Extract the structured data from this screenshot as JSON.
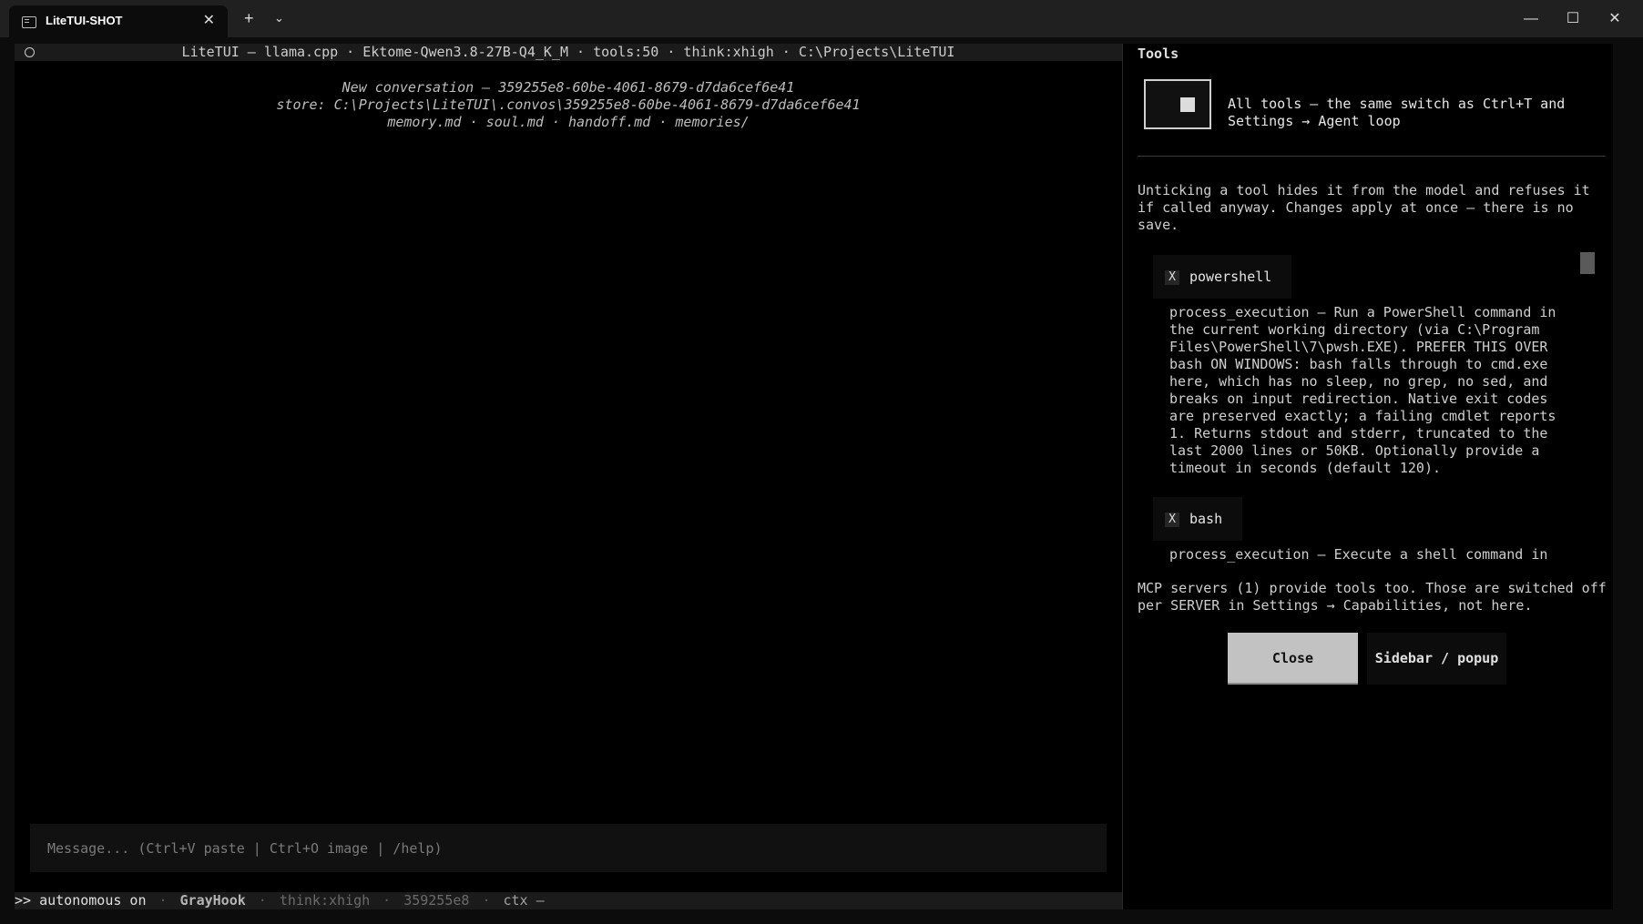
{
  "window": {
    "tab_title": "LiteTUI-SHOT",
    "tab_close": "✕",
    "new_tab": "+",
    "tab_menu": "⌄",
    "minimize": "—",
    "maximize": "☐",
    "close": "✕"
  },
  "chat": {
    "status_line": "LiteTUI — llama.cpp · Ektome-Qwen3.8-27B-Q4_K_M · tools:50 · think:xhigh · C:\\Projects\\LiteTUI",
    "intro": {
      "line1": "New conversation — 359255e8-60be-4061-8679-d7da6cef6e41",
      "line2": "store: C:\\Projects\\LiteTUI\\.convos\\359255e8-60be-4061-8679-d7da6cef6e41",
      "line3": "memory.md · soul.md · handoff.md · memories/"
    },
    "input_placeholder": "Message... (Ctrl+V paste | Ctrl+O image | /help)",
    "bottom": {
      "autonomous": ">> autonomous on",
      "sep": "·",
      "profile": "GrayHook",
      "think": "think:xhigh",
      "convo_id": "359255e8",
      "ctx": "ctx —"
    }
  },
  "tools_panel": {
    "heading": "Tools",
    "master_desc": "All tools — the same switch as Ctrl+T and Settings → Agent loop",
    "note": "Unticking a tool hides it from the model and refuses it if called anyway. Changes apply at once — there is no save.",
    "tools": [
      {
        "check": "X",
        "name": "powershell",
        "desc": "process_execution — Run a PowerShell command in the current working directory (via C:\\Program Files\\PowerShell\\7\\pwsh.EXE). PREFER THIS OVER bash ON WINDOWS: bash falls through to cmd.exe here, which has no sleep, no grep, no sed, and breaks on input redirection. Native exit codes are preserved exactly; a failing cmdlet reports 1. Returns stdout and stderr, truncated to the last 2000 lines or 50KB. Optionally provide a timeout in seconds (default 120)."
      },
      {
        "check": "X",
        "name": "bash",
        "desc": "process_execution — Execute a shell command in the"
      }
    ],
    "mcp_note": "MCP servers (1) provide tools too. Those are switched off per SERVER in Settings → Capabilities, not here.",
    "close_label": "Close",
    "sidebar_label": "Sidebar / popup"
  },
  "colors": {
    "background": "#0c0c0c",
    "pane": "#000000",
    "statusbar": "#1b1b1b",
    "close_button": "#c2c2c2"
  },
  "icons": {
    "tab_icon": "terminal-icon",
    "status_dot": "circle-icon",
    "master_toggle": "toggle-icon"
  }
}
